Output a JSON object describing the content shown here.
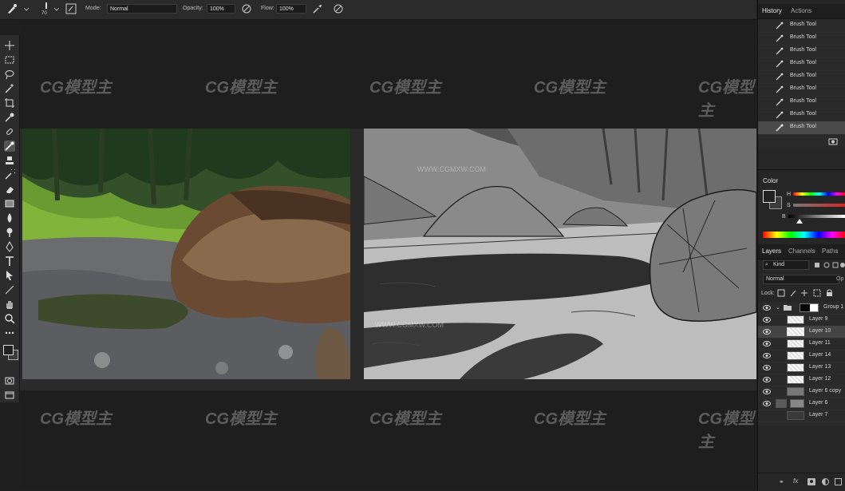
{
  "options_bar": {
    "brush_size": "70",
    "mode_label": "Mode:",
    "mode_value": "Normal",
    "opacity_label": "Opacity:",
    "opacity_value": "100%",
    "flow_label": "Flow:",
    "flow_value": "100%"
  },
  "history_panel": {
    "tabs": [
      "History",
      "Actions"
    ],
    "items": [
      "Brush Tool",
      "Brush Tool",
      "Brush Tool",
      "Brush Tool",
      "Brush Tool",
      "Brush Tool",
      "Brush Tool",
      "Brush Tool",
      "Brush Tool"
    ]
  },
  "color_panel": {
    "title": "Color",
    "slider_labels": [
      "H",
      "S",
      "B"
    ],
    "foreground": "#222222",
    "background": "#3c3c3c"
  },
  "layers_panel": {
    "tabs": [
      "Layers",
      "Channels",
      "Paths"
    ],
    "kind_label": "Kind",
    "blend_mode": "Normal",
    "opacity_label": "Op",
    "lock_label": "Lock:",
    "layers": [
      {
        "name": "Group 1",
        "type": "group"
      },
      {
        "name": "Layer 9",
        "type": "layer"
      },
      {
        "name": "Layer 10",
        "type": "layer"
      },
      {
        "name": "Layer 11",
        "type": "layer"
      },
      {
        "name": "Layer 14",
        "type": "layer"
      },
      {
        "name": "Layer 13",
        "type": "layer"
      },
      {
        "name": "Layer 12",
        "type": "layer"
      },
      {
        "name": "Layer 6 copy",
        "type": "layer"
      },
      {
        "name": "Layer 6",
        "type": "layer"
      },
      {
        "name": "Layer 7",
        "type": "layer"
      }
    ]
  },
  "toolbar": {
    "tools": [
      "move-tool-icon",
      "marquee-tool-icon",
      "lasso-tool-icon",
      "magic-wand-icon",
      "crop-tool-icon",
      "eyedropper-icon",
      "healing-brush-icon",
      "brush-tool-icon",
      "clone-stamp-icon",
      "history-brush-icon",
      "eraser-icon",
      "gradient-tool-icon",
      "blur-tool-icon",
      "dodge-tool-icon",
      "pen-tool-icon",
      "type-tool-icon",
      "path-selection-icon",
      "line-tool-icon",
      "hand-tool-icon",
      "zoom-tool-icon",
      "more-tools-icon"
    ]
  },
  "watermark": {
    "logo": "CG模型主",
    "url": "WWW.CGMXW.COM"
  }
}
